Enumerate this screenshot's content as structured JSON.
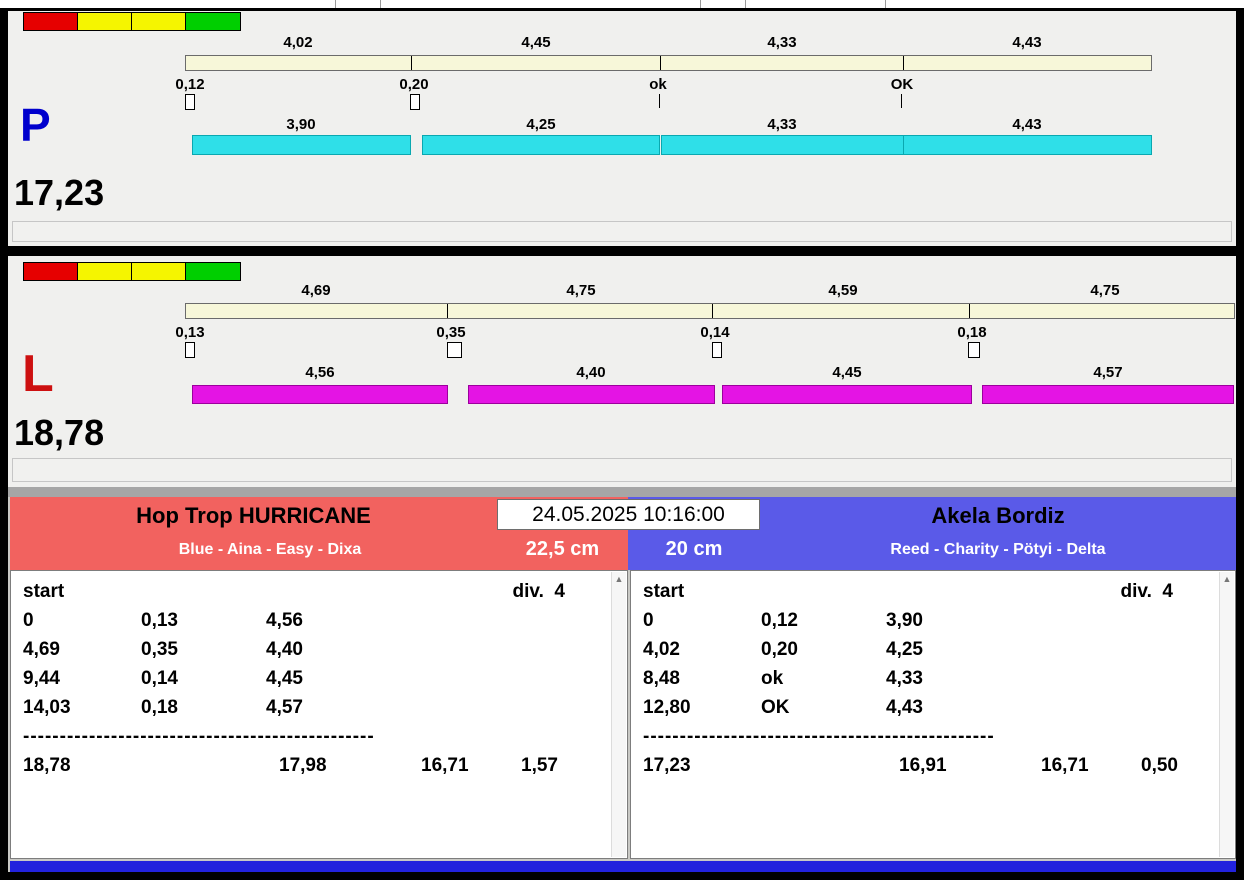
{
  "colors": {
    "lane_p_letter": "#0000cd",
    "lane_l_letter": "#cd1010",
    "bar_p": "#2fdfe8",
    "bar_l": "#e414e4",
    "team_left_bg": "#f2625f",
    "team_right_bg": "#5a5ae8",
    "bottom_bar": "#2222dd",
    "legend": [
      "#e60000",
      "#f5f500",
      "#f5f500",
      "#00cf00"
    ]
  },
  "lanes": [
    {
      "letter": "P",
      "total": "17,23",
      "ruler_labels": [
        "4,02",
        "4,45",
        "4,33",
        "4,43"
      ],
      "mark_labels": [
        "0,12",
        "0,20",
        "ok",
        "OK"
      ],
      "bar_labels": [
        "3,90",
        "4,25",
        "4,33",
        "4,43"
      ]
    },
    {
      "letter": "L",
      "total": "18,78",
      "ruler_labels": [
        "4,69",
        "4,75",
        "4,59",
        "4,75"
      ],
      "mark_labels": [
        "0,13",
        "0,35",
        "0,14",
        "0,18"
      ],
      "bar_labels": [
        "4,56",
        "4,40",
        "4,45",
        "4,57"
      ]
    }
  ],
  "footer": {
    "datetime": "24.05.2025 10:16:00",
    "teams": [
      {
        "name": "Hop Trop HURRICANE",
        "lineup": "Blue - Aina - Easy - Dixa",
        "jump_height": "22,5 cm",
        "table": {
          "start_label": "start",
          "div_label": "div.  4",
          "rows": [
            [
              "0",
              "0,13",
              "4,56"
            ],
            [
              "4,69",
              "0,35",
              "4,40"
            ],
            [
              "9,44",
              "0,14",
              "4,45"
            ],
            [
              "14,03",
              "0,18",
              "4,57"
            ]
          ],
          "separator": "------------------------------------------------",
          "totals": [
            "18,78",
            "17,98",
            "16,71",
            "1,57"
          ]
        }
      },
      {
        "name": "Akela Bordiz",
        "lineup": "Reed - Charity - Pötyi - Delta",
        "jump_height": "20 cm",
        "table": {
          "start_label": "start",
          "div_label": "div.  4",
          "rows": [
            [
              "0",
              "0,12",
              "3,90"
            ],
            [
              "4,02",
              "0,20",
              "4,25"
            ],
            [
              "8,48",
              "ok",
              "4,33"
            ],
            [
              "12,80",
              "OK",
              "4,43"
            ]
          ],
          "separator": "------------------------------------------------",
          "totals": [
            "17,23",
            "16,91",
            "16,71",
            "0,50"
          ]
        }
      }
    ]
  }
}
